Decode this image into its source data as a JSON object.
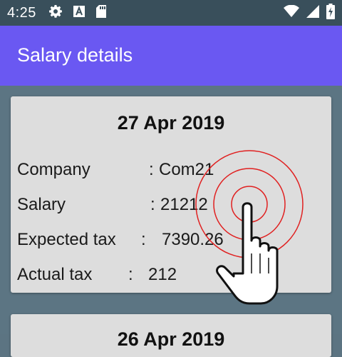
{
  "status_bar": {
    "time": "4:25",
    "left_icons": [
      "gear-icon",
      "a-text-icon",
      "sd-card-icon"
    ],
    "right_icons": [
      "wifi-icon",
      "signal-icon",
      "battery-charging-icon"
    ]
  },
  "app_bar": {
    "title": "Salary details"
  },
  "cards": [
    {
      "date": "27 Apr 2019",
      "rows": [
        {
          "label": "Company",
          "separator": ":",
          "value": "Com21"
        },
        {
          "label": "Salary",
          "separator": ":",
          "value": "21212"
        },
        {
          "label": "Expected tax",
          "separator": ":",
          "value": "7390.26"
        },
        {
          "label": "Actual tax",
          "separator": ":",
          "value": "212"
        }
      ]
    },
    {
      "date": "26 Apr 2019"
    }
  ],
  "colors": {
    "app_bar": "#6a58f2",
    "status_bar": "#394f5b",
    "background": "#5c7583",
    "card": "#dddddd",
    "touch_ring": "#e02020"
  }
}
